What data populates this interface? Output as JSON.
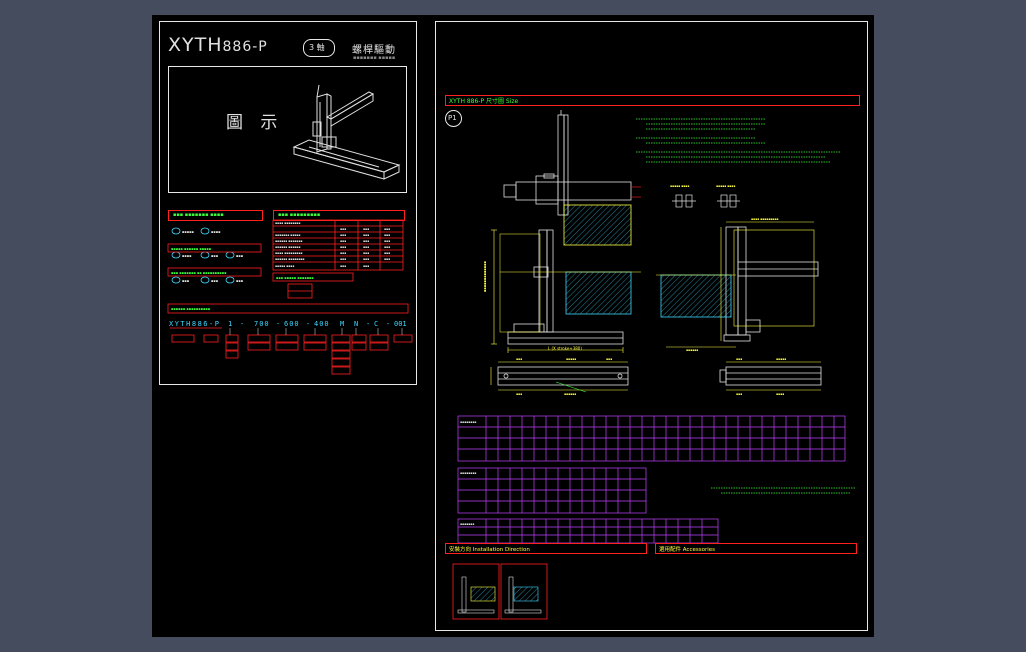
{
  "left_panel": {
    "model": "XYTH",
    "model_suffix": "886-P",
    "axis_count": "3 軸",
    "drive_type": "螺桿驅動",
    "illustration_caption": "圖 示"
  },
  "right_panel": {
    "section_title": "XYTH 886-P 尺寸圖 Size",
    "figure_label": "P1",
    "dim_bottom_total": "L (X stroke+380)",
    "install_direction_label": "安裝方向 Installation Direction",
    "accessories_label": "選用配件 Accessories"
  },
  "colors": {
    "sheet": "#000000",
    "frame": "#e8e8e8",
    "red": "#ff2020",
    "green": "#3cff3c",
    "cyan": "#3cd8ff",
    "magenta": "#c040ff",
    "yellow": "#ffff40"
  }
}
